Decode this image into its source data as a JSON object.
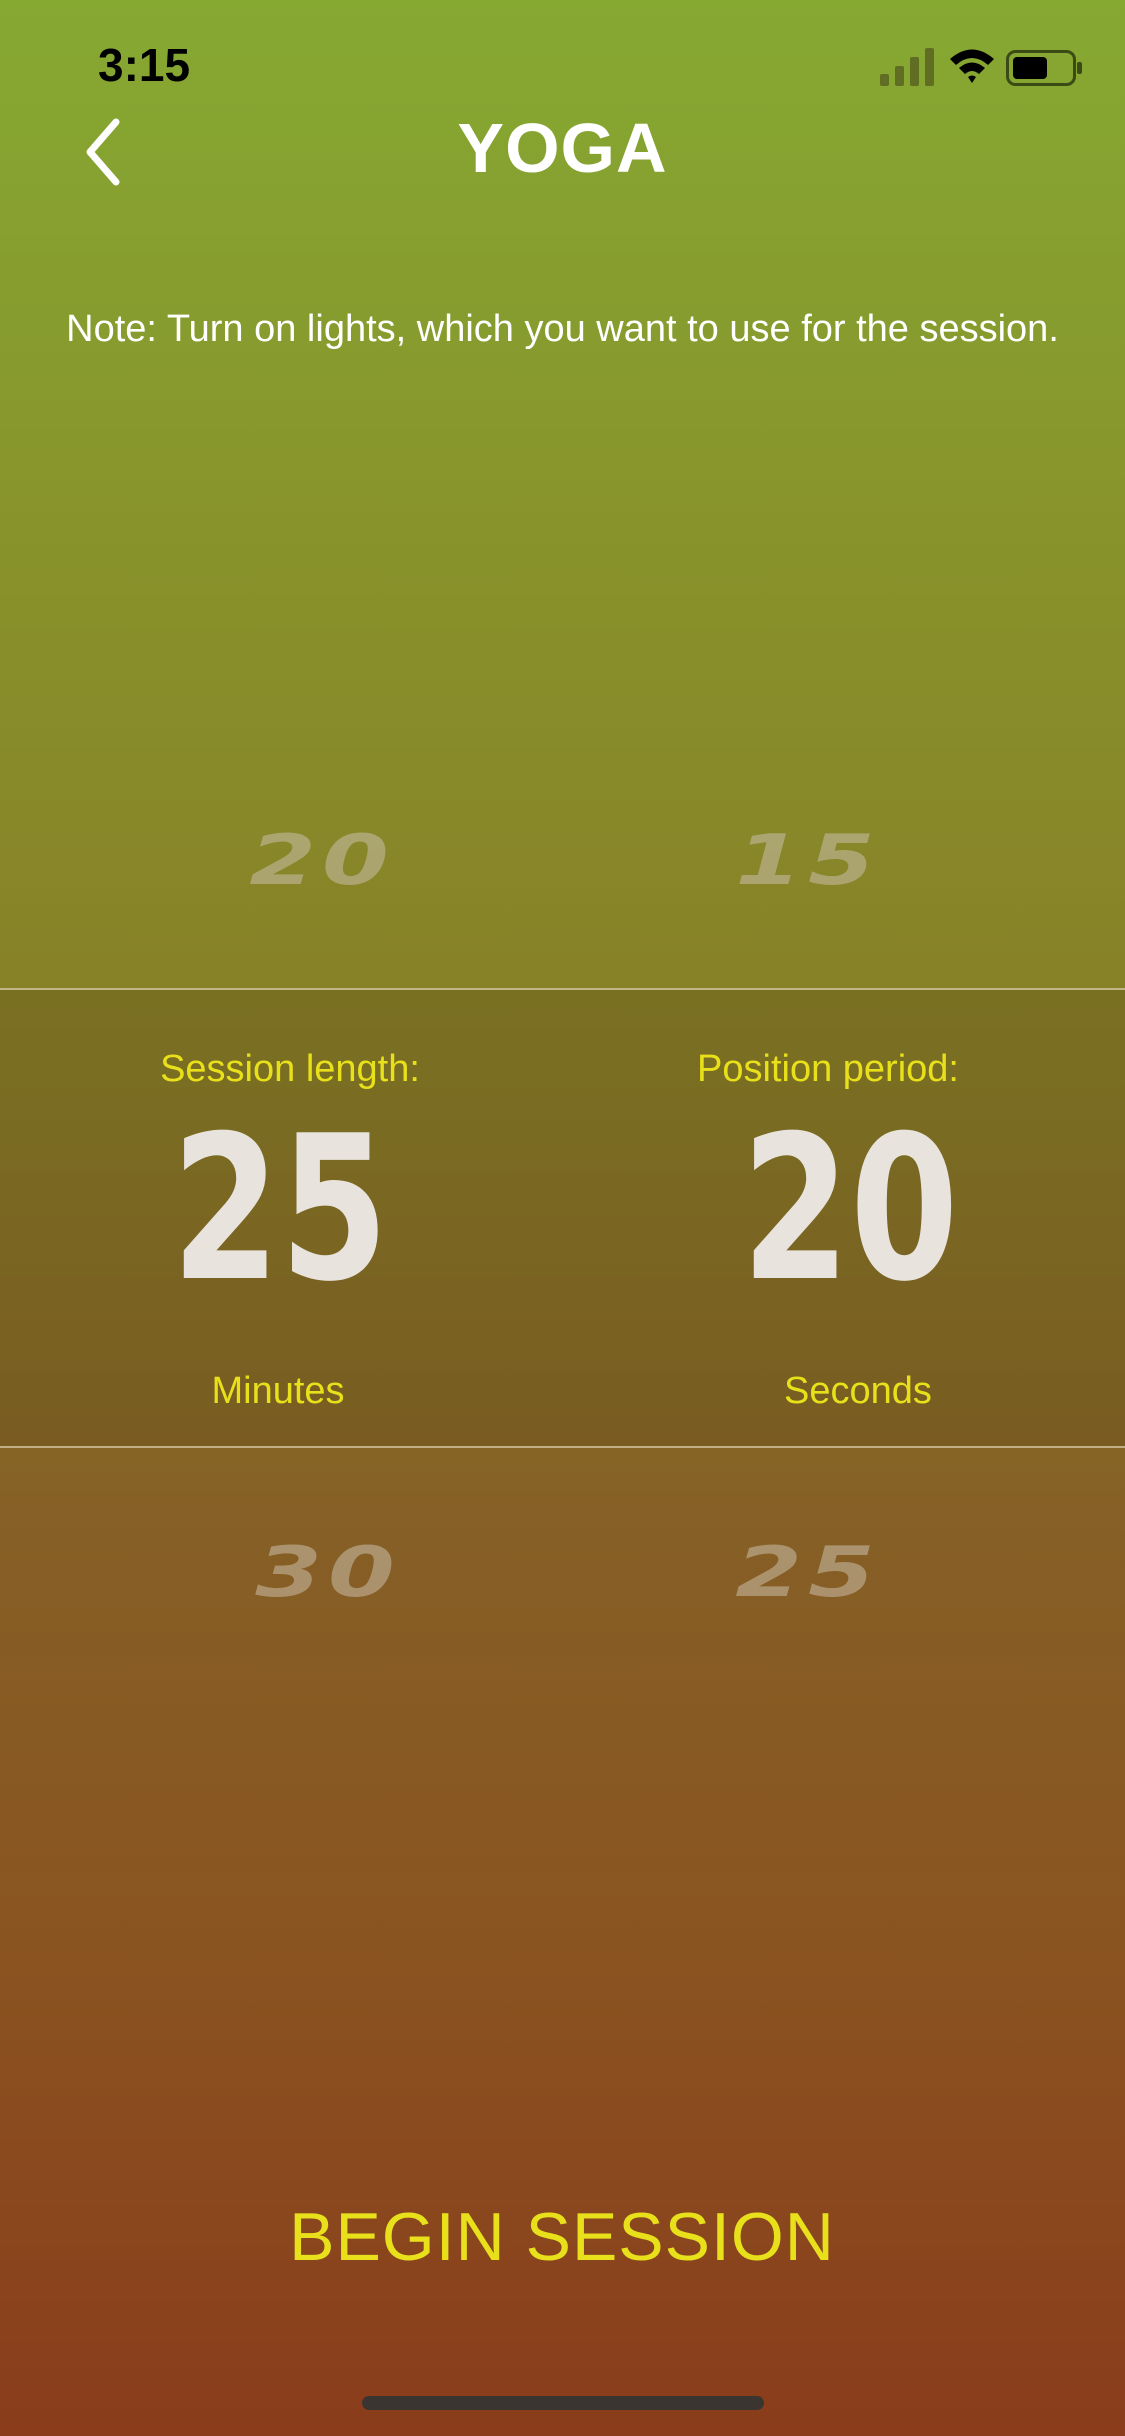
{
  "status_bar": {
    "time": "3:15"
  },
  "header": {
    "title": "YOGA",
    "back_icon": "chevron-left-icon"
  },
  "note": "Note: Turn on lights, which you want to use for the session.",
  "session_length_picker": {
    "label": "Session length:",
    "above_value": "20",
    "selected_value": "25",
    "below_value": "30",
    "unit": "Minutes"
  },
  "position_period_picker": {
    "label": "Position period:",
    "above_value": "15",
    "selected_value": "20",
    "below_value": "25",
    "unit": "Seconds"
  },
  "begin_button_label": "BEGIN SESSION",
  "colors": {
    "accent": "#e8e01b",
    "top_gradient": "#86a932",
    "bottom_gradient": "#8a3c1b"
  }
}
